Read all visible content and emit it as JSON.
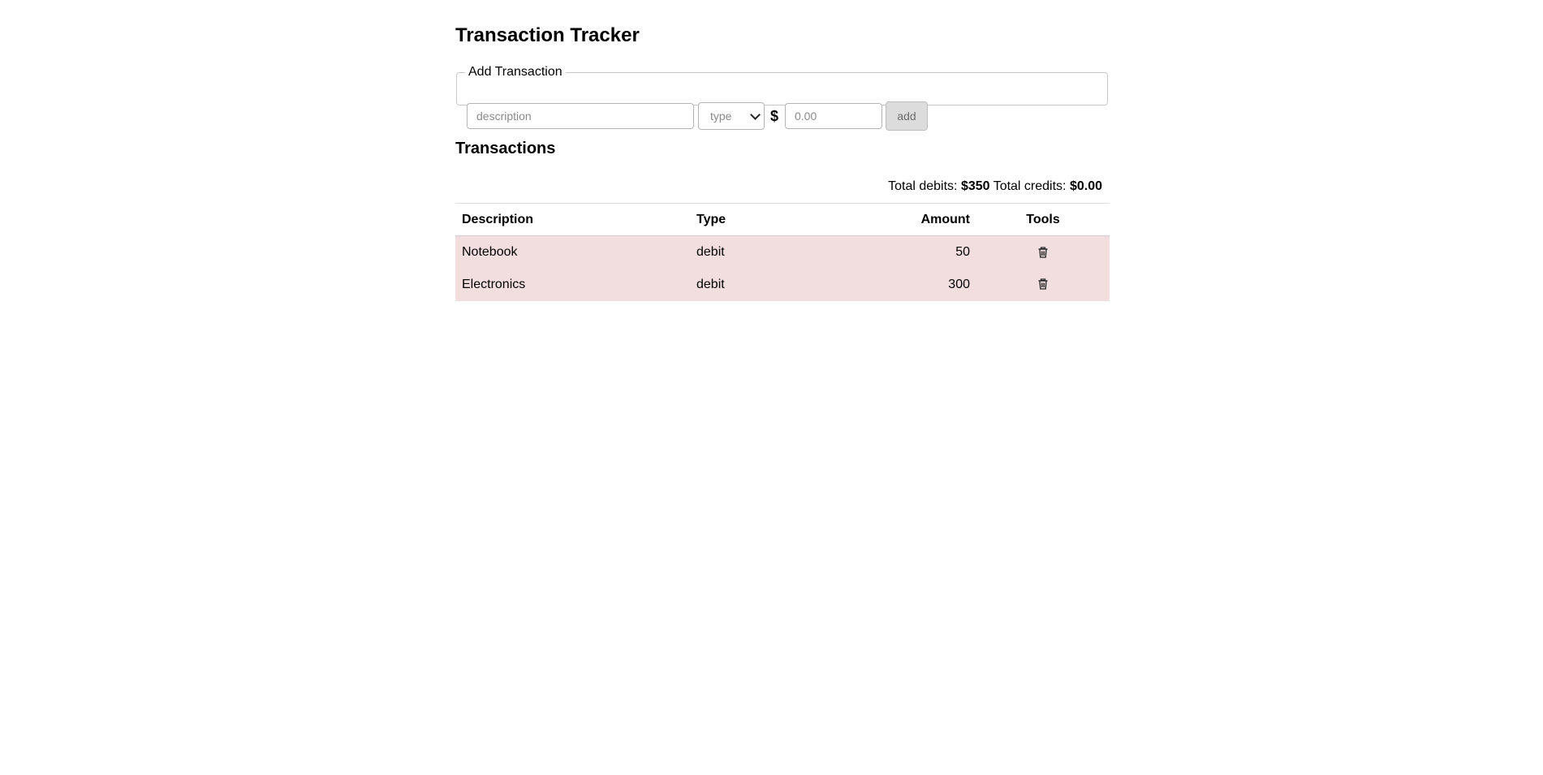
{
  "page": {
    "title": "Transaction Tracker"
  },
  "add_form": {
    "legend": "Add Transaction",
    "description_placeholder": "description",
    "type_selected": "type",
    "currency_symbol": "$",
    "amount_placeholder": "0.00",
    "add_label": "add"
  },
  "transactions": {
    "heading": "Transactions",
    "totals": {
      "debits_label": "Total debits:",
      "debits_value": "$350",
      "credits_label": "Total credits:",
      "credits_value": "$0.00"
    },
    "columns": [
      "Description",
      "Type",
      "Amount",
      "Tools"
    ],
    "rows": [
      {
        "description": "Notebook",
        "type": "debit",
        "amount": "50",
        "tool_icon": "trash-icon"
      },
      {
        "description": "Electronics",
        "type": "debit",
        "amount": "300",
        "tool_icon": "trash-icon"
      }
    ],
    "row_color": "#f2dede"
  }
}
